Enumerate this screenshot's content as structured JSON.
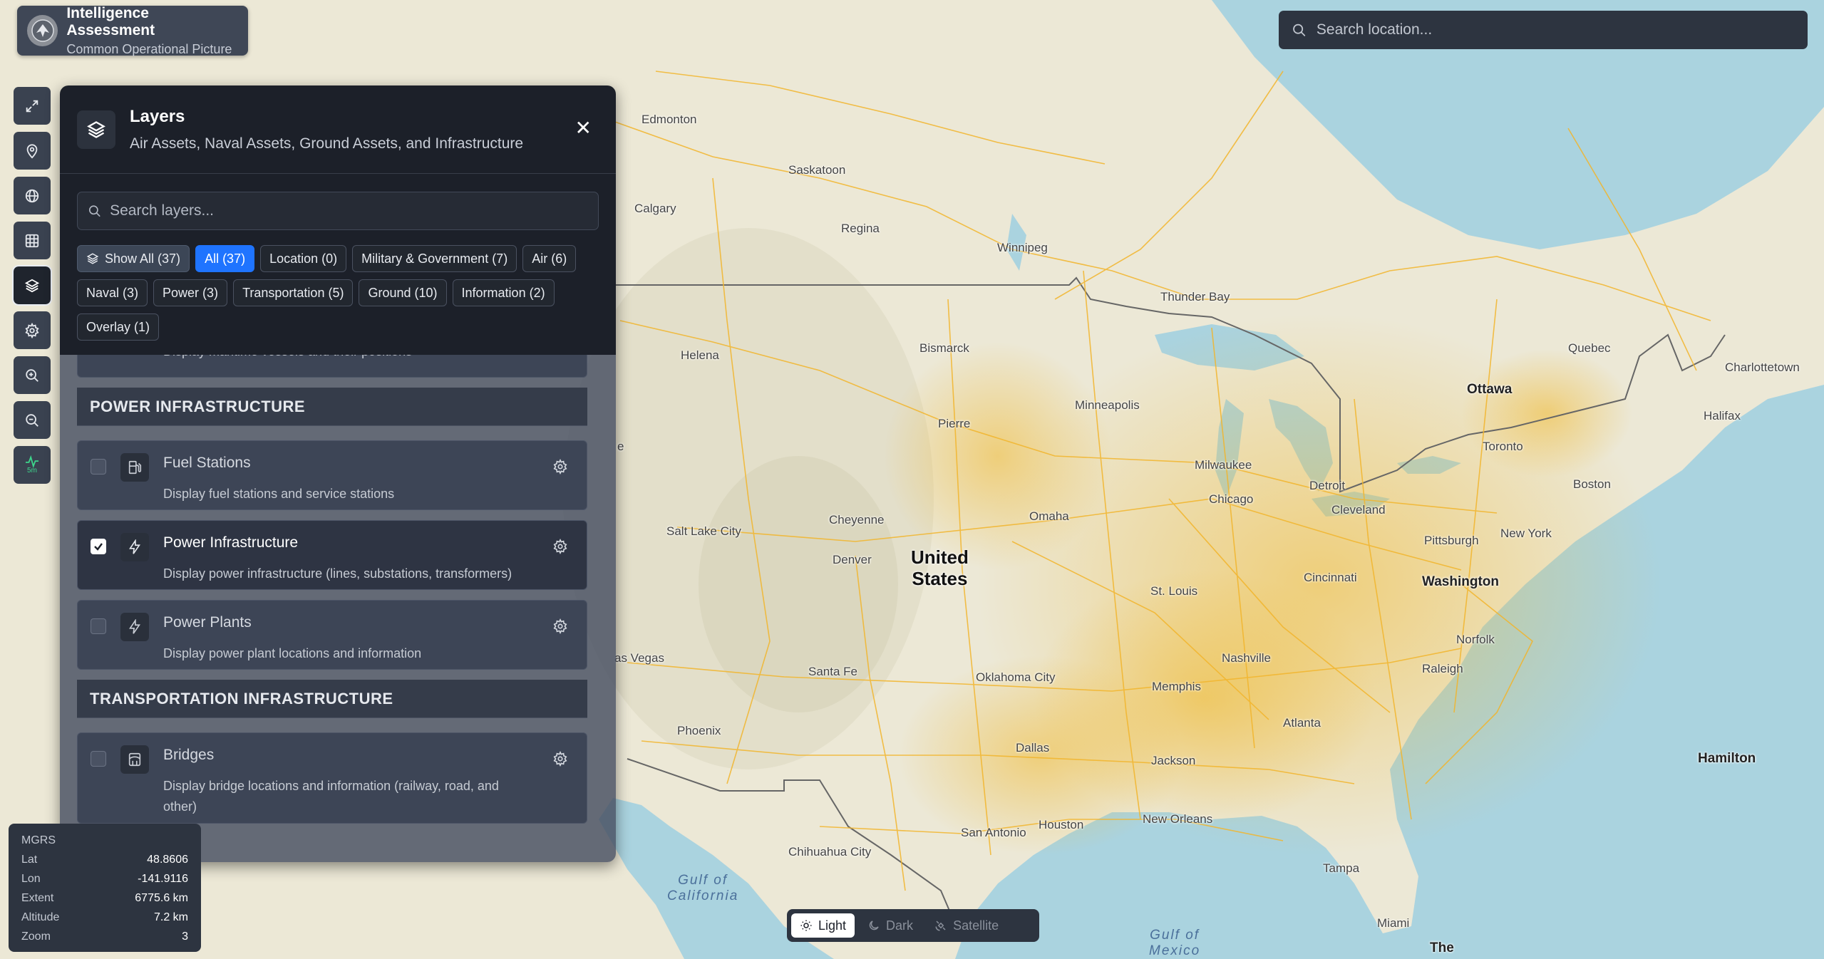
{
  "brand": {
    "title": "Intelligence Assessment",
    "subtitle": "Common Operational Picture"
  },
  "location_search": {
    "placeholder": "Search location..."
  },
  "toolbar": {
    "items": [
      "expand-icon",
      "map-pin-icon",
      "globe-icon",
      "grid-icon",
      "layers-icon",
      "settings-icon",
      "zoom-in-icon",
      "zoom-out-icon",
      "activity-icon"
    ],
    "active": "layers-icon",
    "activity_label": "5m"
  },
  "layers_panel": {
    "title": "Layers",
    "subtitle": "Air Assets, Naval Assets, Ground Assets, and Infrastructure",
    "search_placeholder": "Search layers...",
    "filters": {
      "show_all": "Show All (37)",
      "all": "All (37)",
      "location": "Location (0)",
      "military": "Military & Government (7)",
      "air": "Air (6)",
      "naval": "Naval (3)",
      "power": "Power (3)",
      "transportation": "Transportation (5)",
      "ground": "Ground (10)",
      "information": "Information (2)",
      "overlay": "Overlay (1)"
    },
    "partial_row_desc": "Display maritime vessels and their positions",
    "sections": {
      "power": "POWER INFRASTRUCTURE",
      "transportation": "TRANSPORTATION INFRASTRUCTURE"
    },
    "rows": {
      "fuel": {
        "title": "Fuel Stations",
        "desc": "Display fuel stations and service stations"
      },
      "power_infra": {
        "title": "Power Infrastructure",
        "desc": "Display power infrastructure (lines, substations, transformers)"
      },
      "power_plants": {
        "title": "Power Plants",
        "desc": "Display power plant locations and information"
      },
      "bridges": {
        "title": "Bridges",
        "desc": "Display bridge locations and information (railway, road, and other)"
      }
    }
  },
  "coords": {
    "mgrs_label": "MGRS",
    "lat_label": "Lat",
    "lat_value": "48.8606",
    "lon_label": "Lon",
    "lon_value": "-141.9116",
    "extent_label": "Extent",
    "extent_value": "6775.6 km",
    "altitude_label": "Altitude",
    "altitude_value": "7.2 km",
    "zoom_label": "Zoom",
    "zoom_value": "3"
  },
  "basemap": {
    "light": "Light",
    "dark": "Dark",
    "satellite": "Satellite",
    "selected": "Light"
  },
  "map": {
    "country": "United\nStates",
    "cities": {
      "edmonton": "Edmonton",
      "saskatoon": "Saskatoon",
      "calgary": "Calgary",
      "regina": "Regina",
      "winnipeg": "Winnipeg",
      "thunder_bay": "Thunder Bay",
      "helena": "Helena",
      "bismarck": "Bismarck",
      "quebec": "Quebec",
      "charlottetown": "Charlottetown",
      "ottawa": "Ottawa",
      "halifax": "Halifax",
      "minneapolis": "Minneapolis",
      "pierre": "Pierre",
      "toronto": "Toronto",
      "milwaukee": "Milwaukee",
      "detroit": "Detroit",
      "boston": "Boston",
      "chicago": "Chicago",
      "cleveland": "Cleveland",
      "cheyenne": "Cheyenne",
      "omaha": "Omaha",
      "salt_lake": "Salt Lake City",
      "pittsburgh": "Pittsburgh",
      "new_york": "New York",
      "denver": "Denver",
      "cincinnati": "Cincinnati",
      "washington": "Washington",
      "st_louis": "St. Louis",
      "norfolk": "Norfolk",
      "nashville": "Nashville",
      "las_vegas": "as Vegas",
      "raleigh": "Raleigh",
      "santa_fe": "Santa Fe",
      "oklahoma": "Oklahoma City",
      "memphis": "Memphis",
      "atlanta": "Atlanta",
      "phoenix": "Phoenix",
      "dallas": "Dallas",
      "jackson": "Jackson",
      "hamilton": "Hamilton",
      "houston": "Houston",
      "new_orleans": "New Orleans",
      "san_antonio": "San Antonio",
      "chihuahua": "Chihuahua City",
      "tampa": "Tampa",
      "miami": "Miami",
      "the": "The",
      "edge_e": "e"
    },
    "water": {
      "gulf_ca": "Gulf of\nCalifornia",
      "gulf_mx": "Gulf of\nMexico"
    }
  },
  "colors": {
    "panel": "#1c2029",
    "accent": "#1f74ff",
    "land": "#ede9d8",
    "water": "#aad3df",
    "roads": "#f5b82e"
  }
}
